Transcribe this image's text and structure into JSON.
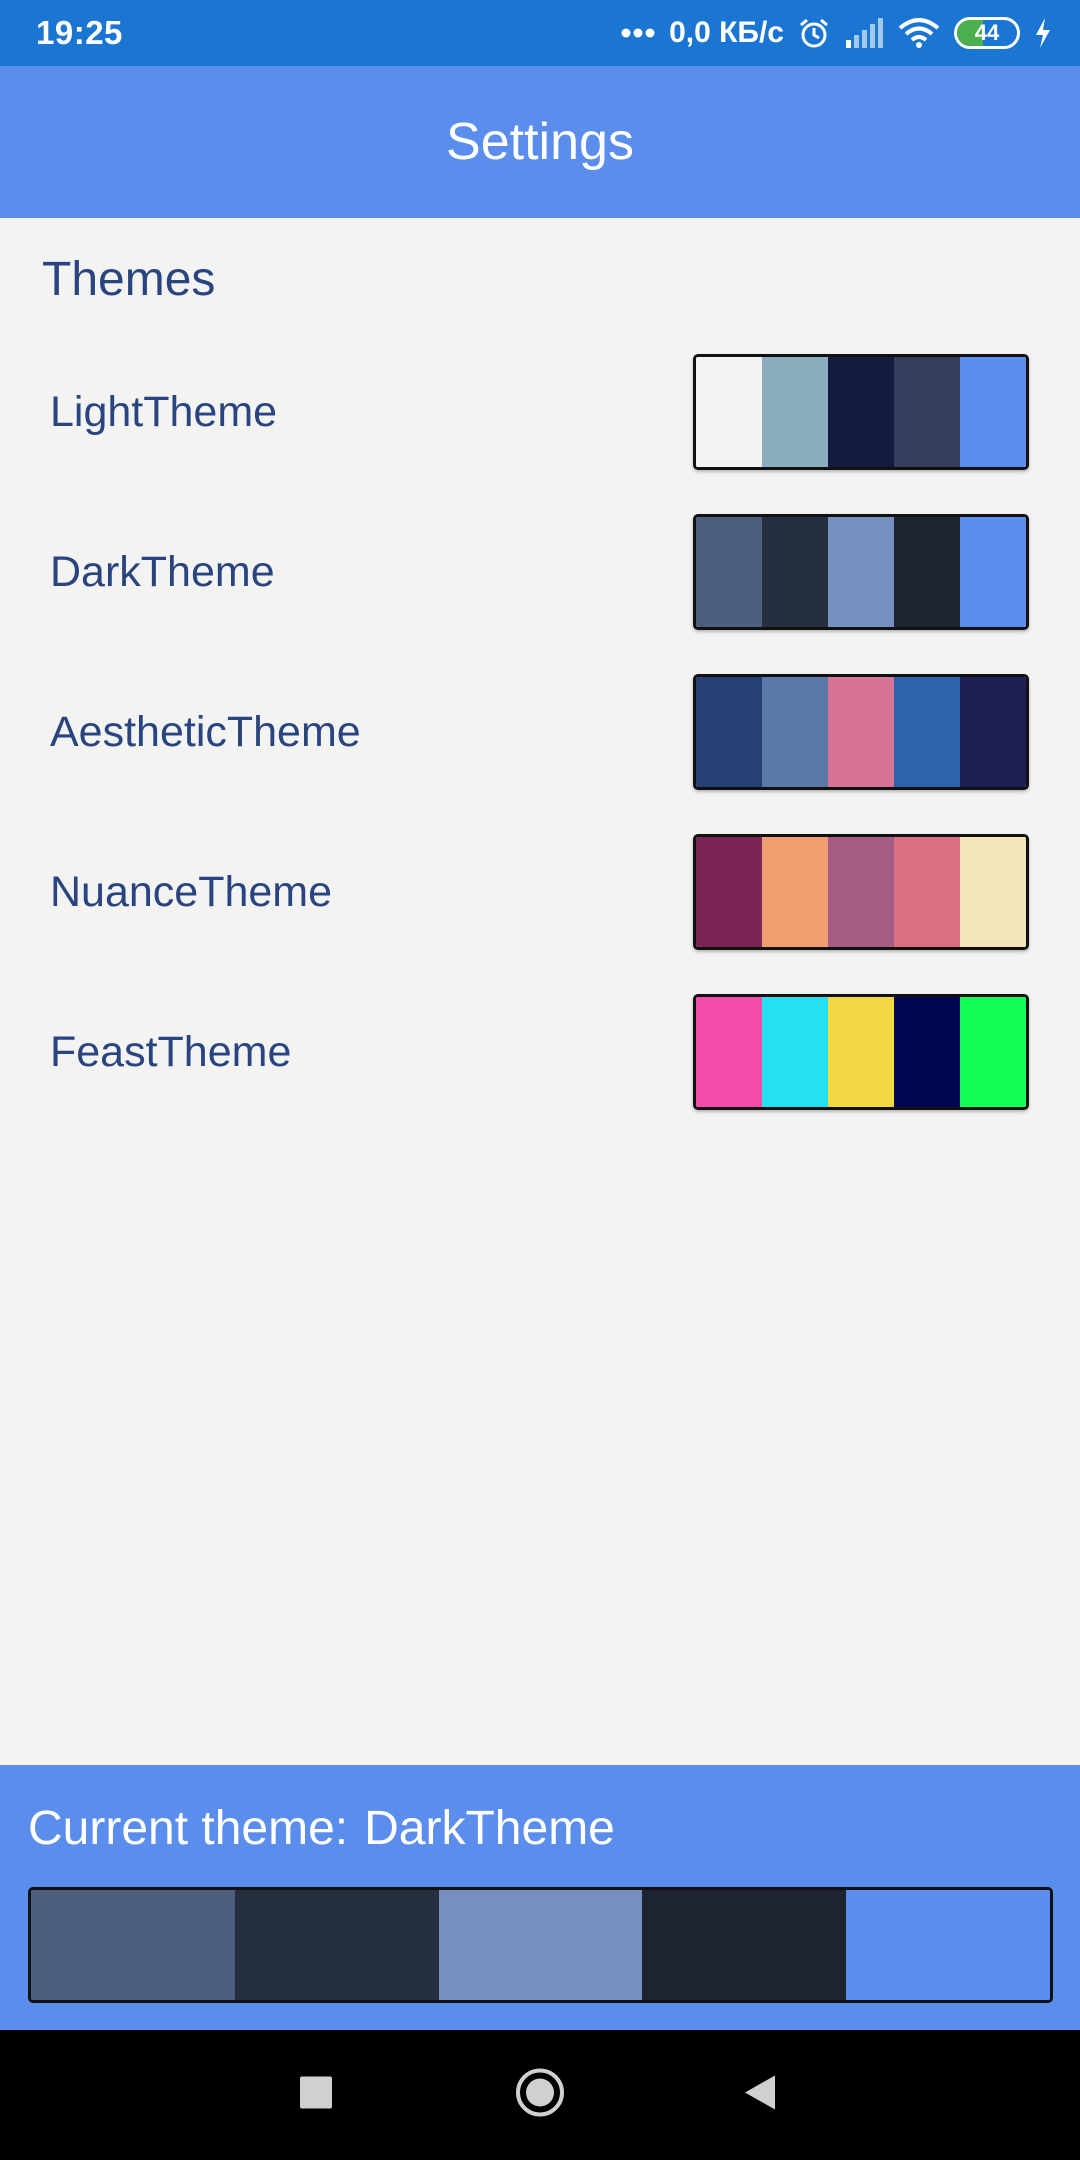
{
  "status_bar": {
    "time": "19:25",
    "network_speed": "0,0 КБ/с",
    "battery_level": "44",
    "battery_percent": 44,
    "icons": [
      "dots-icon",
      "alarm-icon",
      "signal-icon",
      "wifi-icon",
      "battery-icon",
      "charging-icon"
    ]
  },
  "app_bar": {
    "title": "Settings"
  },
  "section": {
    "title": "Themes"
  },
  "themes": [
    {
      "name": "LightTheme",
      "colors": [
        "#f3f3f3",
        "#8badbd",
        "#141c40",
        "#333f5a",
        "#5b8ded"
      ]
    },
    {
      "name": "DarkTheme",
      "colors": [
        "#4e5e7f",
        "#262f3f",
        "#758fbf",
        "#1e2332",
        "#5b8ded"
      ]
    },
    {
      "name": "AestheticTheme",
      "colors": [
        "#273f72",
        "#5a79a8",
        "#d77397",
        "#2f64ac",
        "#1f1e55"
      ]
    },
    {
      "name": "NuanceTheme",
      "colors": [
        "#7c2554",
        "#f19e6e",
        "#a65b84",
        "#dc6f81",
        "#f3e5bc"
      ]
    },
    {
      "name": "FeastTheme",
      "colors": [
        "#f34da9",
        "#25dff3",
        "#f3d843",
        "#00064f",
        "#12ff57"
      ]
    }
  ],
  "current": {
    "label": "Current theme:",
    "theme_name": "DarkTheme",
    "colors": [
      "#4e5e7f",
      "#262f3f",
      "#758fbf",
      "#1e2332",
      "#5b8ded"
    ]
  },
  "nav_bar": {
    "icons": [
      "recents-square-icon",
      "home-circle-icon",
      "back-triangle-icon"
    ]
  }
}
